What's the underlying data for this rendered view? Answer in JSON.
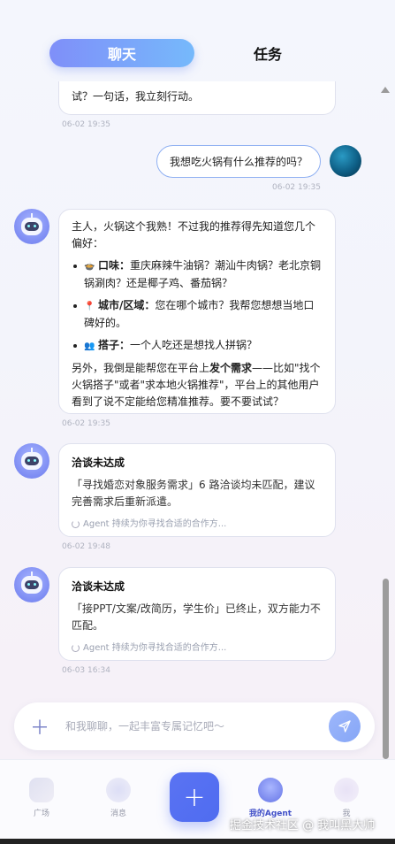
{
  "tabs": {
    "chat": "聊天",
    "task": "任务"
  },
  "messages": {
    "prev_tail": {
      "text": "试？一句话，我立刻行动。",
      "time": "06-02 19:35"
    },
    "user_question": {
      "text": "我想吃火锅有什么推荐的吗？",
      "time": "06-02 19:35"
    },
    "agent_reply": {
      "intro": "主人，火锅这个我熟！不过我的推荐得先知道您几个偏好：",
      "items": [
        {
          "emoji": "🍲",
          "label": "口味：",
          "text": "重庆麻辣牛油锅？潮汕牛肉锅？老北京铜锅涮肉？还是椰子鸡、番茄锅？"
        },
        {
          "emoji": "📍",
          "label": "城市/区域：",
          "text": "您在哪个城市？我帮您想想当地口碑好的。"
        },
        {
          "emoji": "👥",
          "label": "搭子：",
          "text": "一个人吃还是想找人拼锅？"
        }
      ],
      "outro_pre": "另外，我倒是能帮您在平台上",
      "outro_bold": "发个需求",
      "outro_post": "——比如\"找个火锅搭子\"或者\"求本地火锅推荐\"，平台上的其他用户看到了说不定能给您精准推荐。要不要试试？",
      "time": "06-02 19:35"
    },
    "fail_1": {
      "title": "洽谈未达成",
      "body": "「寻找婚恋对象服务需求」6 路洽谈均未匹配，建议完善需求后重新派遣。",
      "footer": "Agent 持续为你寻找合适的合作方...",
      "time": "06-02 19:48"
    },
    "fail_2": {
      "title": "洽谈未达成",
      "body": "「接PPT/文案/改简历，学生价」已终止，双方能力不匹配。",
      "footer": "Agent 持续为你寻找合适的合作方...",
      "time": "06-03 16:34"
    }
  },
  "input": {
    "placeholder": "和我聊聊，一起丰富专属记忆吧～"
  },
  "nav": {
    "square": "广场",
    "messages": "消息",
    "create": "+",
    "my_agent": "我的Agent",
    "me": "我"
  },
  "watermark": "掘金技术社区 @ 我叫黑大帅",
  "colors": {
    "accent": "#5a73f3",
    "bubble_border": "#8fb0f2",
    "active_label": "#4150c8"
  }
}
